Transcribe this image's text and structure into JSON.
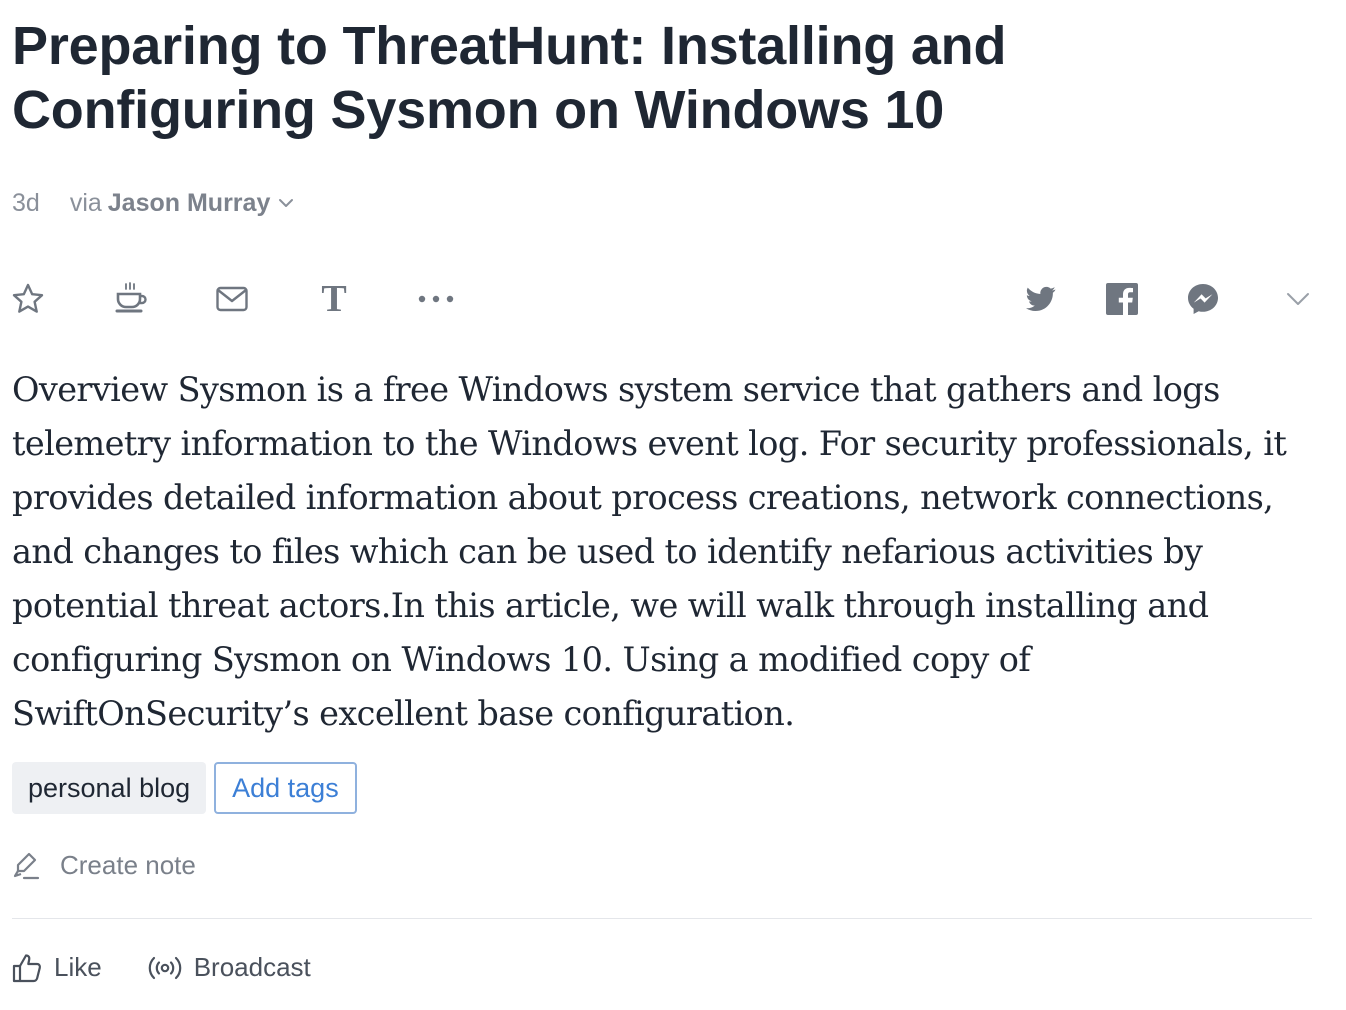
{
  "article": {
    "title": "Preparing to ThreatHunt: Installing and Configuring Sysmon on Windows 10",
    "age": "3d",
    "via": "via",
    "author": "Jason Murray",
    "summary": "Overview Sysmon is a free Windows system service  that gathers and logs telemetry information to the Windows event log. For security professionals, it provides detailed information about process creations, network connections, and changes to files which can be used to identify nefarious activities by potential threat actors.In this article, we will walk through installing and configuring Sysmon on Windows 10. Using a modified copy of SwiftOnSecurity’s excellent base configuration."
  },
  "toolbar": {
    "left_icons": [
      "star-icon",
      "coffee-cup-icon",
      "mail-icon",
      "text-icon",
      "more-icon"
    ],
    "text_glyph": "T",
    "share_icons": [
      "twitter-icon",
      "facebook-icon",
      "messenger-icon",
      "chevron-down-icon"
    ]
  },
  "tags": {
    "items": [
      "personal blog"
    ],
    "add_label": "Add tags"
  },
  "note": {
    "label": "Create note"
  },
  "actions": {
    "like_label": "Like",
    "broadcast_label": "Broadcast"
  },
  "colors": {
    "text": "#1f2733",
    "muted": "#8a909a",
    "icon": "#6f7680",
    "link": "#3c7fd6",
    "tag_bg": "#eef0f3",
    "divider": "#e4e6ea"
  }
}
